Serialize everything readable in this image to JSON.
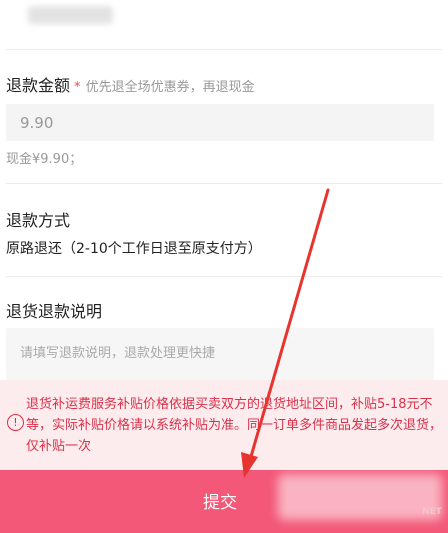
{
  "refund_amount": {
    "label": "退款金额",
    "required_mark": "*",
    "hint": "优先退全场优惠券，再退现金",
    "value": "9.90",
    "cash_note": "现金¥9.90；"
  },
  "refund_method": {
    "label": "退款方式",
    "value": "原路退还（2-10个工作日退至原支付方）"
  },
  "refund_description": {
    "label": "退货退款说明",
    "placeholder": "请填写退款说明，退款处理更快捷"
  },
  "notice": {
    "icon": "info-icon",
    "text": "退货补运费服务补贴价格依据买卖双方的退货地址区间，补贴5-18元不等，实际补贴价格请以系统补贴为准。同一订单多件商品发起多次退货，仅补贴一次"
  },
  "submit": {
    "label": "提交"
  },
  "watermark": {
    "suffix": "NET"
  },
  "colors": {
    "accent": "#f35878",
    "notice_text": "#d9304a",
    "notice_bg": "#fdecee",
    "arrow": "#e8342f"
  }
}
